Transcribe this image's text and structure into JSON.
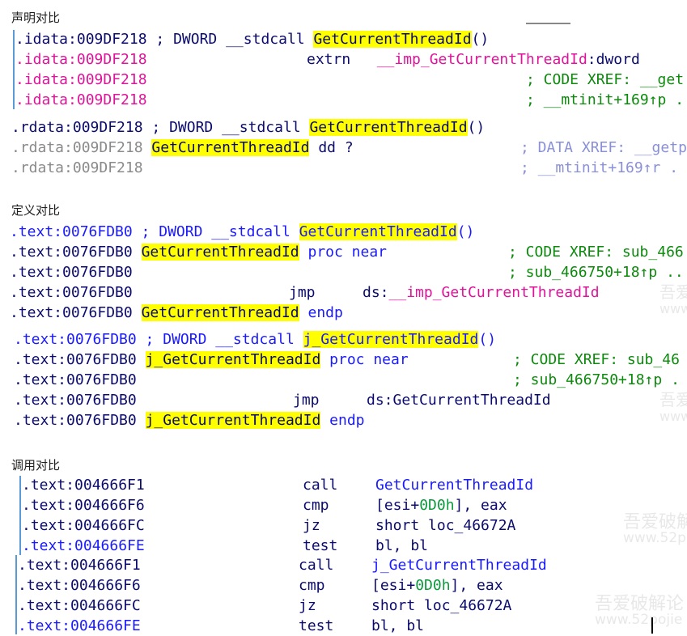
{
  "headings": {
    "decl": "声明对比",
    "def": "定义对比",
    "call": "调用对比"
  },
  "decl": {
    "l1": {
      "addr": ".idata:009DF218",
      "pre": " ; DWORD __stdcall ",
      "name": "GetCurrentThreadId",
      "post": "()"
    },
    "l2": {
      "addr": ".idata:009DF218",
      "extrn": "extrn",
      "imp": "__imp_GetCurrentThreadId",
      "dw": ":dword"
    },
    "l3": {
      "addr": ".idata:009DF218",
      "xref": "; CODE XREF: __get"
    },
    "l4": {
      "addr": ".idata:009DF218",
      "xref": "; __mtinit+169↑p .."
    },
    "l5": {
      "addr": ".rdata:009DF218",
      "pre": " ; DWORD __stdcall ",
      "name": "GetCurrentThreadId",
      "post": "()"
    },
    "l6": {
      "addr": ".rdata:009DF218",
      "name": "GetCurrentThreadId",
      "rest": " dd ?",
      "xref": "; DATA XREF: __getp"
    },
    "l7": {
      "addr": ".rdata:009DF218",
      "xref": "; __mtinit+169↑r ."
    }
  },
  "def": {
    "a1": {
      "addr": ".text:0076FDB0",
      "pre": " ; DWORD __stdcall ",
      "name": "GetCurrentThreadId",
      "post": "()"
    },
    "a2": {
      "addr": ".text:0076FDB0",
      "name": "GetCurrentThreadId",
      "rest": " proc near",
      "xref": "; CODE XREF: sub_466"
    },
    "a3": {
      "addr": ".text:0076FDB0",
      "xref": "; sub_466750+18↑p .."
    },
    "a4": {
      "addr": ".text:0076FDB0",
      "mn": "jmp",
      "ds": "ds:",
      "imp": "__imp_GetCurrentThreadId"
    },
    "a5": {
      "addr": ".text:0076FDB0",
      "name": "GetCurrentThreadId",
      "rest": " endp"
    },
    "b1": {
      "addr": ".text:0076FDB0",
      "pre": " ; DWORD __stdcall ",
      "name": "j_GetCurrentThreadId",
      "post": "()"
    },
    "b2": {
      "addr": ".text:0076FDB0",
      "name": "j_GetCurrentThreadId",
      "rest": " proc near",
      "xref": "; CODE XREF: sub_46"
    },
    "b3": {
      "addr": ".text:0076FDB0",
      "xref": "; sub_466750+18↑p ."
    },
    "b4": {
      "addr": ".text:0076FDB0",
      "mn": "jmp",
      "op": "ds:GetCurrentThreadId"
    },
    "b5": {
      "addr": ".text:0076FDB0",
      "name": "j_GetCurrentThreadId",
      "rest": " endp"
    }
  },
  "call": {
    "a1": {
      "addr": ".text:004666F1",
      "mn": "call",
      "op": "GetCurrentThreadId"
    },
    "a2": {
      "addr": ".text:004666F6",
      "mn": "cmp",
      "op1": "[esi+",
      "num": "0D0h",
      "op2": "], eax"
    },
    "a3": {
      "addr": ".text:004666FC",
      "mn": "jz",
      "op": "short loc_46672A"
    },
    "a4": {
      "addr": ".text:004666FE",
      "mn": "test",
      "op": "bl, bl"
    },
    "b1": {
      "addr": ".text:004666F1",
      "mn": "call",
      "op": "j_GetCurrentThreadId"
    },
    "b2": {
      "addr": ".text:004666F6",
      "mn": "cmp",
      "op1": "[esi+",
      "num": "0D0h",
      "op2": "], eax"
    },
    "b3": {
      "addr": ".text:004666FC",
      "mn": "jz",
      "op": "short loc_46672A"
    },
    "b4": {
      "addr": ".text:004666FE",
      "mn": "test",
      "op": "bl, bl"
    }
  },
  "watermarks": {
    "w1": "吾爱",
    "w2": "www",
    "w3": "吾爱",
    "w4": "www",
    "w5": "吾爱破解",
    "w6": "www.52p",
    "w7": "吾爱破解论",
    "w8": "www.52pojie"
  }
}
